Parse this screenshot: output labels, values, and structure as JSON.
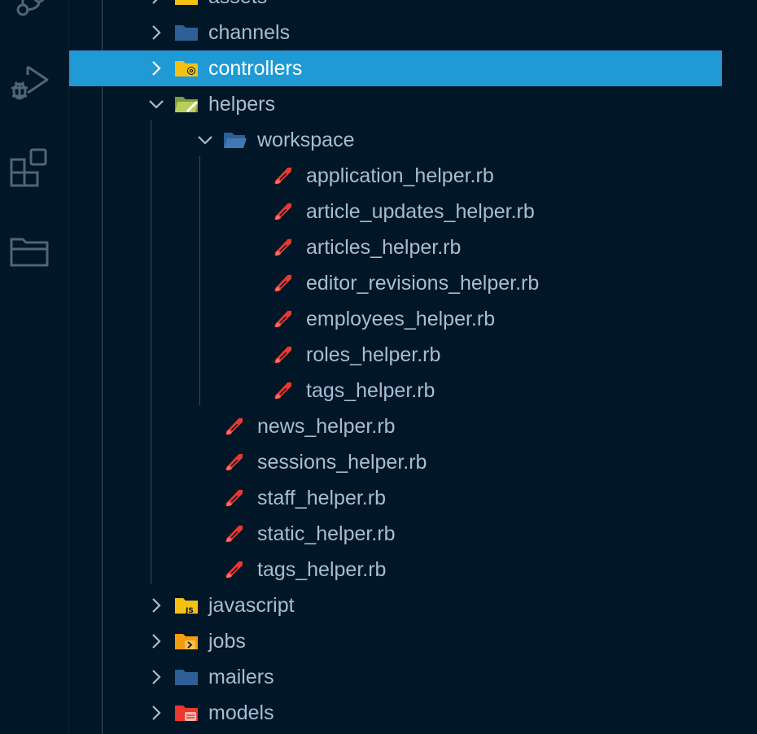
{
  "activity_bar": {
    "icons": [
      "source-control-icon",
      "run-debug-icon",
      "extensions-icon",
      "explorer-icon"
    ]
  },
  "tree": {
    "partial_top": "assets",
    "items": [
      {
        "label": "channels",
        "type": "folder",
        "state": "collapsed",
        "icon": "folder-icon"
      },
      {
        "label": "controllers",
        "type": "folder",
        "state": "collapsed",
        "icon": "folder-controllers-icon",
        "selected": true
      },
      {
        "label": "helpers",
        "type": "folder",
        "state": "expanded",
        "icon": "folder-helpers-icon"
      },
      {
        "label": "workspace",
        "type": "folder",
        "state": "expanded",
        "icon": "folder-open-icon"
      },
      {
        "label": "application_helper.rb",
        "type": "file",
        "icon": "ruby-icon"
      },
      {
        "label": "article_updates_helper.rb",
        "type": "file",
        "icon": "ruby-icon"
      },
      {
        "label": "articles_helper.rb",
        "type": "file",
        "icon": "ruby-icon"
      },
      {
        "label": "editor_revisions_helper.rb",
        "type": "file",
        "icon": "ruby-icon"
      },
      {
        "label": "employees_helper.rb",
        "type": "file",
        "icon": "ruby-icon"
      },
      {
        "label": "roles_helper.rb",
        "type": "file",
        "icon": "ruby-icon"
      },
      {
        "label": "tags_helper.rb",
        "type": "file",
        "icon": "ruby-icon"
      },
      {
        "label": "news_helper.rb",
        "type": "file",
        "icon": "ruby-icon"
      },
      {
        "label": "sessions_helper.rb",
        "type": "file",
        "icon": "ruby-icon"
      },
      {
        "label": "staff_helper.rb",
        "type": "file",
        "icon": "ruby-icon"
      },
      {
        "label": "static_helper.rb",
        "type": "file",
        "icon": "ruby-icon"
      },
      {
        "label": "tags_helper.rb",
        "type": "file",
        "icon": "ruby-icon"
      },
      {
        "label": "javascript",
        "type": "folder",
        "state": "collapsed",
        "icon": "folder-js-icon"
      },
      {
        "label": "jobs",
        "type": "folder",
        "state": "collapsed",
        "icon": "folder-jobs-icon"
      },
      {
        "label": "mailers",
        "type": "folder",
        "state": "collapsed",
        "icon": "folder-icon"
      },
      {
        "label": "models",
        "type": "folder",
        "state": "collapsed",
        "icon": "folder-models-icon"
      }
    ]
  },
  "colors": {
    "background": "#011627",
    "selection": "#1f9ad5",
    "text": "#a8bcd4",
    "ruby": "#e8382f",
    "folder_blue": "#2e5f95",
    "folder_yellow": "#f4c014"
  }
}
